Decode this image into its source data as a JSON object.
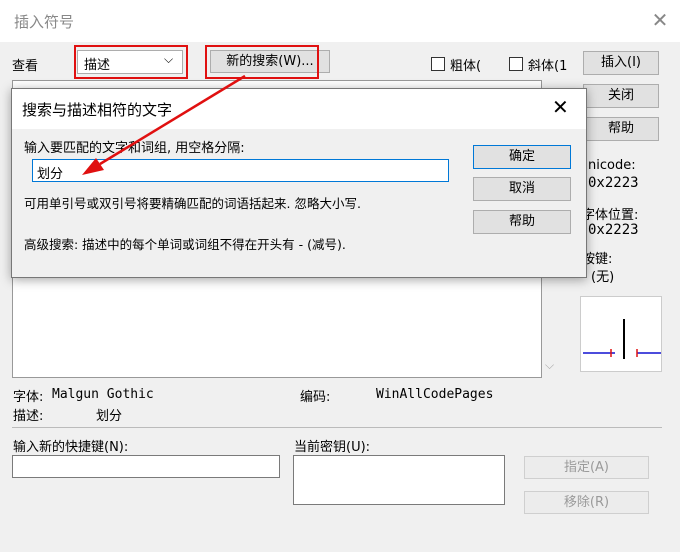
{
  "window": {
    "title": "插入符号",
    "close_glyph": "✕"
  },
  "toolbar": {
    "view_label": "查看",
    "view_value": "描述",
    "new_search_label": "新的搜索(W)...",
    "bold_label": "粗体(",
    "italic_label": "斜体(1",
    "insert_label": "插入(I)",
    "close_label": "关闭",
    "help_label": "帮助"
  },
  "right_panel": {
    "unicode_label": "nicode:",
    "unicode_value": "0x2223",
    "font_pos_label": "字体位置:",
    "font_pos_value": "0x2223",
    "shortcut_label": "按键:",
    "shortcut_value": "(无)"
  },
  "info": {
    "font_label": "字体:",
    "font_value": "Malgun Gothic",
    "encoding_label": "编码:",
    "encoding_value": "WinAllCodePages",
    "desc_label": "描述:",
    "desc_value": "划分"
  },
  "shortcut_section": {
    "new_key_label": "输入新的快捷键(N):",
    "current_key_label": "当前密钥(U):",
    "assign_label": "指定(A)",
    "remove_label": "移除(R)"
  },
  "search_dialog": {
    "title": "搜索与描述相符的文字",
    "close_glyph": "✕",
    "prompt": "输入要匹配的文字和词组, 用空格分隔:",
    "input_value": "划分",
    "hint": "可用单引号或双引号将要精确匹配的词语括起来. 忽略大小写.",
    "advanced": "高级搜索: 描述中的每个单词或词组不得在开头有 - (减号).",
    "ok_label": "确定",
    "cancel_label": "取消",
    "help_label": "帮助"
  },
  "colors": {
    "annotation_red": "#e01010",
    "preview_blue": "#1010d0",
    "preview_red": "#e01010"
  }
}
